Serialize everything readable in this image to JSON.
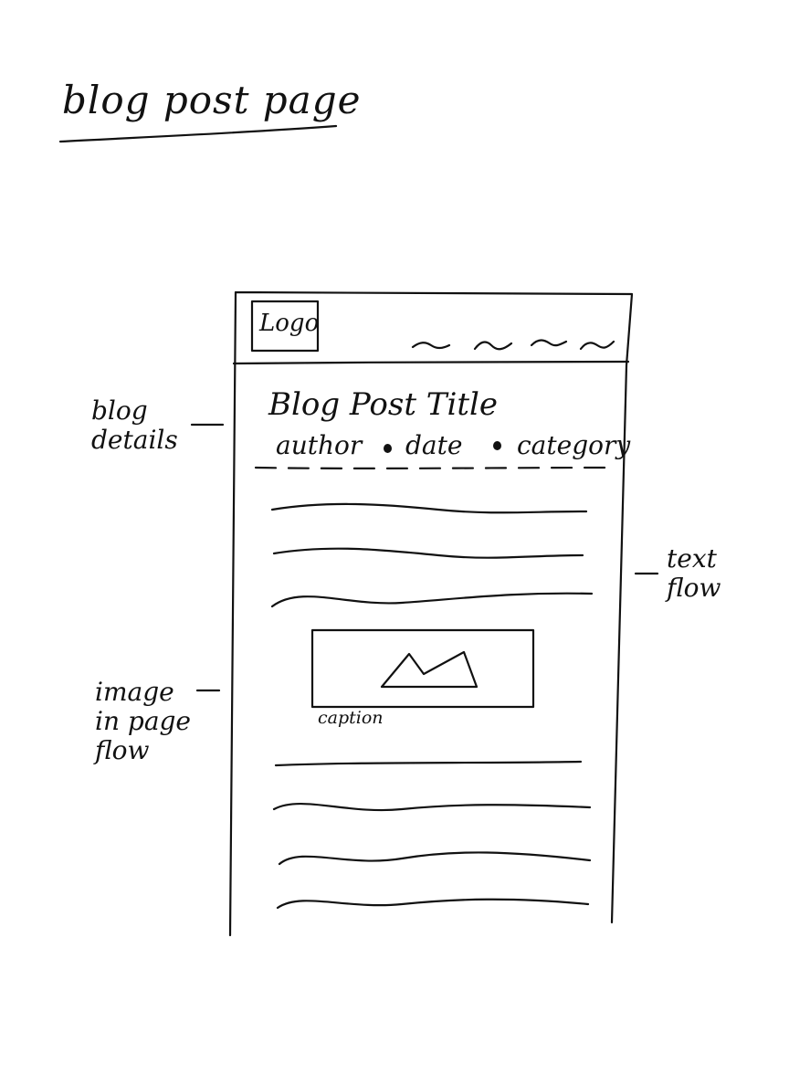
{
  "page_title": "blog post page",
  "annotations": {
    "blog_details": "blog details",
    "text_flow": "text flow",
    "image_in_page_flow": "image in page flow"
  },
  "mockup": {
    "logo": "Logo",
    "nav_items": [
      "~",
      "~",
      "~",
      "~"
    ],
    "post_title": "Blog Post Title",
    "meta": {
      "author": "author",
      "date": "date",
      "category": "category"
    },
    "image": {
      "icon": "mountain-image-icon",
      "caption": "caption"
    },
    "text_lines_before_image": 3,
    "text_lines_after_image": 4
  }
}
